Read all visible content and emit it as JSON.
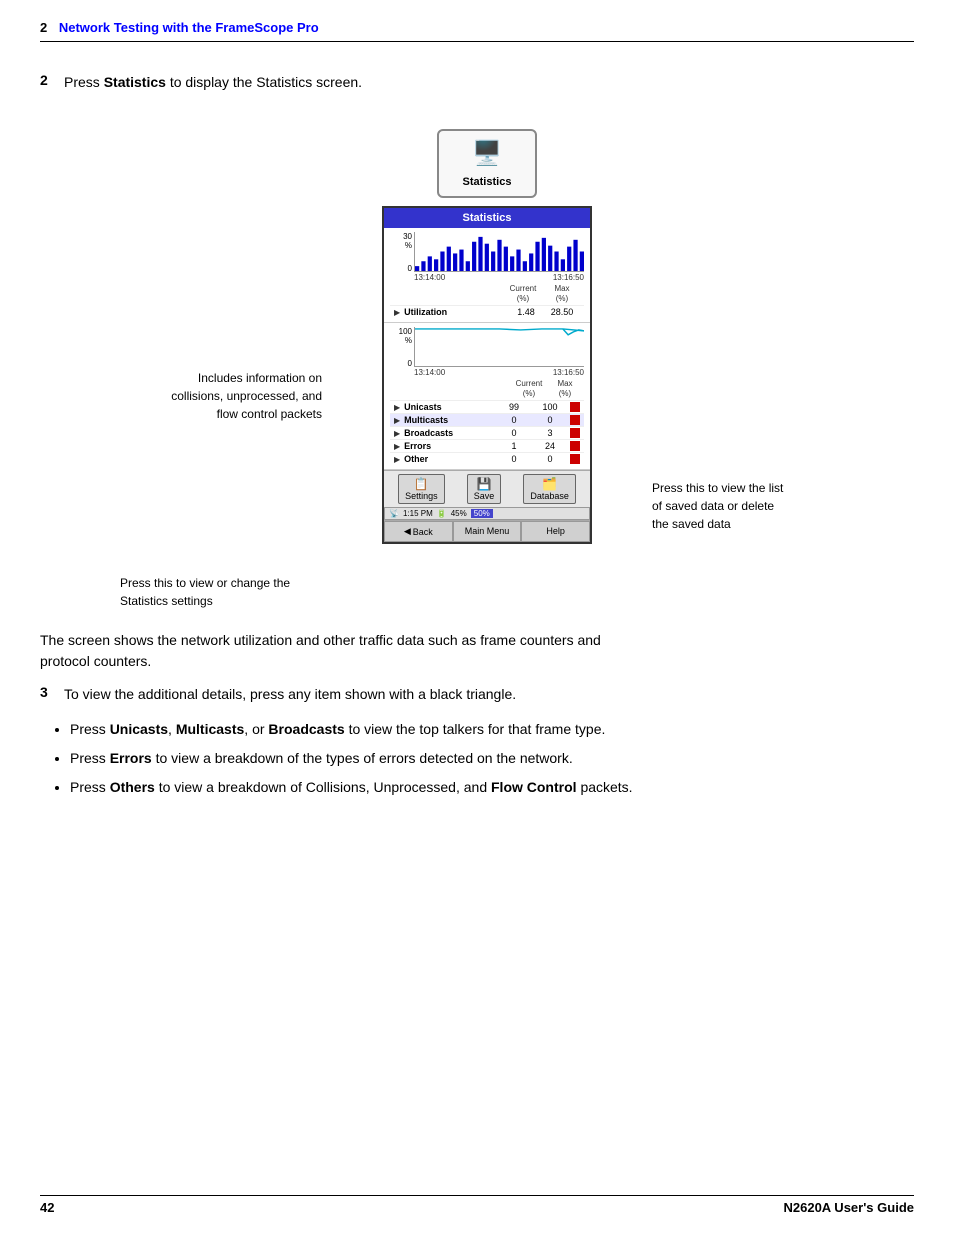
{
  "header": {
    "chapter_num": "2",
    "chapter_title": "Network Testing with the FrameScope Pro"
  },
  "step2": {
    "num": "2",
    "text": "Press ",
    "bold": "Statistics",
    "rest": " to display the Statistics screen."
  },
  "device_icon": {
    "label": "Statistics"
  },
  "stats_screen": {
    "title": "Statistics",
    "chart1": {
      "scale_top": "30",
      "scale_mid": "%",
      "scale_zero": "0",
      "time_start": "13:14:00",
      "time_end": "13:16:50"
    },
    "chart1_header": {
      "col1": "Current (%)",
      "col2": "Max (%)"
    },
    "chart1_rows": [
      {
        "label": "Utilization",
        "current": "1.48",
        "max": "28.50",
        "color": false
      }
    ],
    "chart2": {
      "scale_top": "100",
      "scale_mid": "%",
      "scale_zero": "0",
      "time_start": "13:14:00",
      "time_end": "13:16:50"
    },
    "chart2_header": {
      "col1": "Current (%)",
      "col2": "Max (%)"
    },
    "chart2_rows": [
      {
        "label": "Unicasts",
        "current": "99",
        "max": "100",
        "color": true
      },
      {
        "label": "Multicasts",
        "current": "0",
        "max": "0",
        "color": true
      },
      {
        "label": "Broadcasts",
        "current": "0",
        "max": "3",
        "color": true
      },
      {
        "label": "Errors",
        "current": "1",
        "max": "24",
        "color": true
      },
      {
        "label": "Other",
        "current": "0",
        "max": "0",
        "color": true
      }
    ],
    "toolbar": {
      "settings_label": "Settings",
      "save_label": "Save",
      "database_label": "Database"
    },
    "status_bar": {
      "time": "1:15 PM",
      "battery": "45%",
      "memory": "50%"
    },
    "nav": {
      "back_label": "Back",
      "main_menu_label": "Main Menu",
      "help_label": "Help"
    }
  },
  "annotation_left_collisions": "Includes information on collisions, unprocessed, and flow control packets",
  "annotation_left_settings": "Press this to view or change the Statistics settings",
  "annotation_right_database": "Press this to view the list of saved data or delete the saved data",
  "body_text": "The screen shows the network utilization and other traffic data such as frame counters and protocol counters.",
  "step3": {
    "num": "3",
    "text": "To view the additional details, press any item shown with a black triangle."
  },
  "bullets": [
    {
      "text": "Press ",
      "bold1": "Unicasts",
      "sep1": ", ",
      "bold2": "Multicasts",
      "sep2": ", or ",
      "bold3": "Broadcasts",
      "rest": " to view the top talkers for that frame type."
    },
    {
      "text": "Press ",
      "bold1": "Errors",
      "rest": " to view a breakdown of the types of errors detected on the network."
    },
    {
      "text": "Press ",
      "bold1": "Others",
      "rest": " to view a breakdown of Collisions, Unprocessed, and ",
      "bold2": "Flow Control",
      "rest2": " packets."
    }
  ],
  "footer": {
    "page_num": "42",
    "title": "N2620A User's Guide"
  }
}
